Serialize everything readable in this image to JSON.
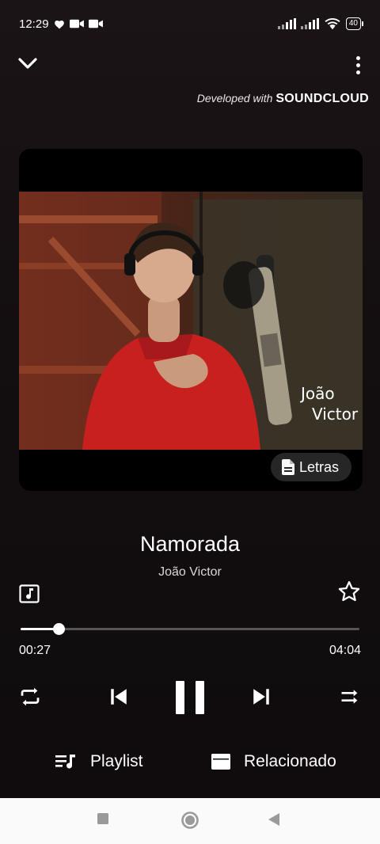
{
  "status_bar": {
    "time": "12:29",
    "battery": "40"
  },
  "header": {
    "developed_prefix": "Developed with ",
    "developed_brand": "SOUNDCLOUD"
  },
  "artwork": {
    "overlay_name_line1": "João",
    "overlay_name_line2": "Victor",
    "lyrics_label": "Letras"
  },
  "track": {
    "title": "Namorada",
    "artist": "João Victor"
  },
  "progress": {
    "elapsed": "00:27",
    "total": "04:04",
    "fraction": 0.112
  },
  "tabs": {
    "playlist_label": "Playlist",
    "related_label": "Relacionado"
  },
  "icons": {
    "collapse": "chevron-down-icon",
    "more": "more-vert-icon",
    "lyrics": "document-icon",
    "music": "music-note-icon",
    "favorite": "star-outline-icon",
    "repeat": "repeat-icon",
    "previous": "skip-previous-icon",
    "pause": "pause-icon",
    "next": "skip-next-icon",
    "shuffle": "shuffle-icon",
    "playlist": "queue-music-icon",
    "related": "related-card-icon"
  }
}
